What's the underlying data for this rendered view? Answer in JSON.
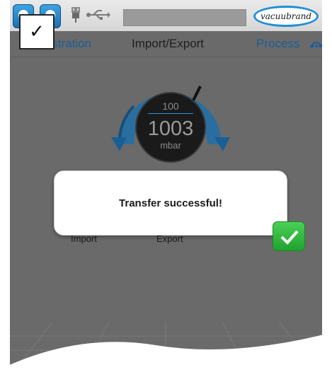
{
  "brand": {
    "logo_text": "vacuubrand"
  },
  "header": {
    "checkbox_mark": "✓"
  },
  "tabs": [
    {
      "label": "nistration"
    },
    {
      "label": "Import/Export"
    },
    {
      "label": "Process"
    }
  ],
  "gauge": {
    "setpoint": "100",
    "value": "1003",
    "unit": "mbar"
  },
  "buttons": {
    "import_label": "Import",
    "export_label": "Export"
  },
  "dialog": {
    "message": "Transfer successful!"
  },
  "colors": {
    "accent": "#1a5e96",
    "gauge_ring": "#1e6fa8",
    "confirm": "#2bbf3a",
    "logo_ring": "#1f8fd6"
  },
  "icons": [
    "user-icon",
    "user-icon",
    "usb-plug-icon",
    "usb-icon",
    "eye-icon",
    "check-icon"
  ]
}
